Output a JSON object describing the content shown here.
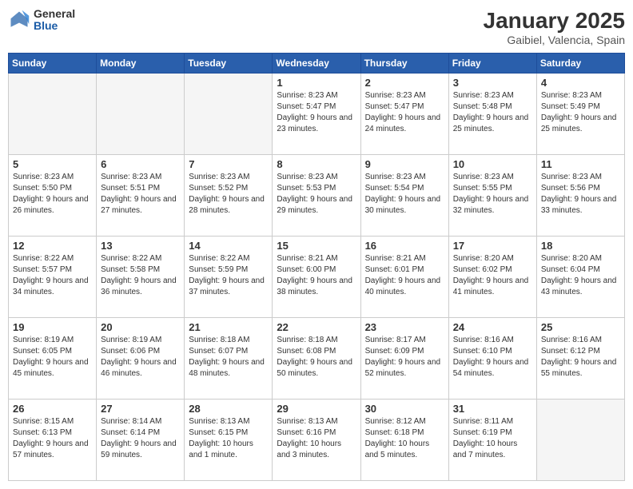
{
  "logo": {
    "general": "General",
    "blue": "Blue"
  },
  "title": "January 2025",
  "location": "Gaibiel, Valencia, Spain",
  "days_of_week": [
    "Sunday",
    "Monday",
    "Tuesday",
    "Wednesday",
    "Thursday",
    "Friday",
    "Saturday"
  ],
  "weeks": [
    [
      {
        "day": "",
        "info": ""
      },
      {
        "day": "",
        "info": ""
      },
      {
        "day": "",
        "info": ""
      },
      {
        "day": "1",
        "info": "Sunrise: 8:23 AM\nSunset: 5:47 PM\nDaylight: 9 hours\nand 23 minutes."
      },
      {
        "day": "2",
        "info": "Sunrise: 8:23 AM\nSunset: 5:47 PM\nDaylight: 9 hours\nand 24 minutes."
      },
      {
        "day": "3",
        "info": "Sunrise: 8:23 AM\nSunset: 5:48 PM\nDaylight: 9 hours\nand 25 minutes."
      },
      {
        "day": "4",
        "info": "Sunrise: 8:23 AM\nSunset: 5:49 PM\nDaylight: 9 hours\nand 25 minutes."
      }
    ],
    [
      {
        "day": "5",
        "info": "Sunrise: 8:23 AM\nSunset: 5:50 PM\nDaylight: 9 hours\nand 26 minutes."
      },
      {
        "day": "6",
        "info": "Sunrise: 8:23 AM\nSunset: 5:51 PM\nDaylight: 9 hours\nand 27 minutes."
      },
      {
        "day": "7",
        "info": "Sunrise: 8:23 AM\nSunset: 5:52 PM\nDaylight: 9 hours\nand 28 minutes."
      },
      {
        "day": "8",
        "info": "Sunrise: 8:23 AM\nSunset: 5:53 PM\nDaylight: 9 hours\nand 29 minutes."
      },
      {
        "day": "9",
        "info": "Sunrise: 8:23 AM\nSunset: 5:54 PM\nDaylight: 9 hours\nand 30 minutes."
      },
      {
        "day": "10",
        "info": "Sunrise: 8:23 AM\nSunset: 5:55 PM\nDaylight: 9 hours\nand 32 minutes."
      },
      {
        "day": "11",
        "info": "Sunrise: 8:23 AM\nSunset: 5:56 PM\nDaylight: 9 hours\nand 33 minutes."
      }
    ],
    [
      {
        "day": "12",
        "info": "Sunrise: 8:22 AM\nSunset: 5:57 PM\nDaylight: 9 hours\nand 34 minutes."
      },
      {
        "day": "13",
        "info": "Sunrise: 8:22 AM\nSunset: 5:58 PM\nDaylight: 9 hours\nand 36 minutes."
      },
      {
        "day": "14",
        "info": "Sunrise: 8:22 AM\nSunset: 5:59 PM\nDaylight: 9 hours\nand 37 minutes."
      },
      {
        "day": "15",
        "info": "Sunrise: 8:21 AM\nSunset: 6:00 PM\nDaylight: 9 hours\nand 38 minutes."
      },
      {
        "day": "16",
        "info": "Sunrise: 8:21 AM\nSunset: 6:01 PM\nDaylight: 9 hours\nand 40 minutes."
      },
      {
        "day": "17",
        "info": "Sunrise: 8:20 AM\nSunset: 6:02 PM\nDaylight: 9 hours\nand 41 minutes."
      },
      {
        "day": "18",
        "info": "Sunrise: 8:20 AM\nSunset: 6:04 PM\nDaylight: 9 hours\nand 43 minutes."
      }
    ],
    [
      {
        "day": "19",
        "info": "Sunrise: 8:19 AM\nSunset: 6:05 PM\nDaylight: 9 hours\nand 45 minutes."
      },
      {
        "day": "20",
        "info": "Sunrise: 8:19 AM\nSunset: 6:06 PM\nDaylight: 9 hours\nand 46 minutes."
      },
      {
        "day": "21",
        "info": "Sunrise: 8:18 AM\nSunset: 6:07 PM\nDaylight: 9 hours\nand 48 minutes."
      },
      {
        "day": "22",
        "info": "Sunrise: 8:18 AM\nSunset: 6:08 PM\nDaylight: 9 hours\nand 50 minutes."
      },
      {
        "day": "23",
        "info": "Sunrise: 8:17 AM\nSunset: 6:09 PM\nDaylight: 9 hours\nand 52 minutes."
      },
      {
        "day": "24",
        "info": "Sunrise: 8:16 AM\nSunset: 6:10 PM\nDaylight: 9 hours\nand 54 minutes."
      },
      {
        "day": "25",
        "info": "Sunrise: 8:16 AM\nSunset: 6:12 PM\nDaylight: 9 hours\nand 55 minutes."
      }
    ],
    [
      {
        "day": "26",
        "info": "Sunrise: 8:15 AM\nSunset: 6:13 PM\nDaylight: 9 hours\nand 57 minutes."
      },
      {
        "day": "27",
        "info": "Sunrise: 8:14 AM\nSunset: 6:14 PM\nDaylight: 9 hours\nand 59 minutes."
      },
      {
        "day": "28",
        "info": "Sunrise: 8:13 AM\nSunset: 6:15 PM\nDaylight: 10 hours\nand 1 minute."
      },
      {
        "day": "29",
        "info": "Sunrise: 8:13 AM\nSunset: 6:16 PM\nDaylight: 10 hours\nand 3 minutes."
      },
      {
        "day": "30",
        "info": "Sunrise: 8:12 AM\nSunset: 6:18 PM\nDaylight: 10 hours\nand 5 minutes."
      },
      {
        "day": "31",
        "info": "Sunrise: 8:11 AM\nSunset: 6:19 PM\nDaylight: 10 hours\nand 7 minutes."
      },
      {
        "day": "",
        "info": ""
      }
    ]
  ]
}
